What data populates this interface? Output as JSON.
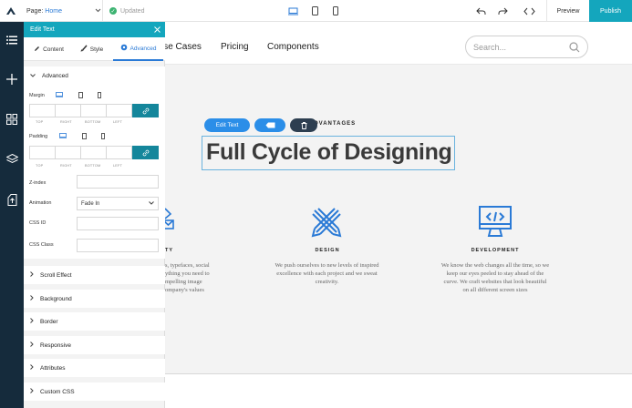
{
  "topbar": {
    "page_label": "Page:",
    "page_value": "Home",
    "status": "Updated",
    "preview_label": "Preview",
    "publish_label": "Publish"
  },
  "site": {
    "nav": [
      "Use Cases",
      "Pricing",
      "Components"
    ],
    "search_placeholder": "Search...",
    "eyebrow": "ADVANTAGES",
    "headline": "Full Cycle of Designing",
    "features": [
      {
        "title": "CREATIVITY",
        "lines": [
          "Colors, typefaces, social",
          "everything you need to",
          "create compelling image",
          "of your company's values"
        ],
        "visible_title": "TY",
        "visible_lines": [
          "s, typefaces, social",
          "ything you need to",
          "mpelling image",
          "ompany's values"
        ]
      },
      {
        "title": "DESIGN",
        "lines": [
          "We push ourselves to new levels of inspired",
          "excellence with each project and we sweat",
          "creativity."
        ]
      },
      {
        "title": "DEVELOPMENT",
        "lines": [
          "We know the web changes all the time, so we",
          "keep our eyes peeled to stay ahead of the",
          "curve. We craft websites that look beautiful",
          "on all different screen sizes"
        ]
      }
    ]
  },
  "toolbar": {
    "edit_text_label": "Edit Text"
  },
  "panel": {
    "title": "Edit Text",
    "tabs": [
      "Content",
      "Style",
      "Advanced"
    ],
    "advanced_section": "Advanced",
    "margin_label": "Margin",
    "padding_label": "Padding",
    "sides": [
      "TOP",
      "RIGHT",
      "BOTTOM",
      "LEFT"
    ],
    "zindex_label": "Z-index",
    "animation_label": "Animation",
    "animation_value": "Fade In",
    "cssid_label": "CSS ID",
    "cssclass_label": "CSS Class",
    "sections": [
      "Scroll Effect",
      "Background",
      "Border",
      "Responsive",
      "Attributes",
      "Custom CSS"
    ]
  },
  "colors": {
    "accent": "#14a6bd",
    "rail": "#152b3c",
    "toolbar_blue": "#2b8ee8",
    "toolbar_dark": "#2d3e50",
    "icon_blue": "#2a7ad6"
  }
}
